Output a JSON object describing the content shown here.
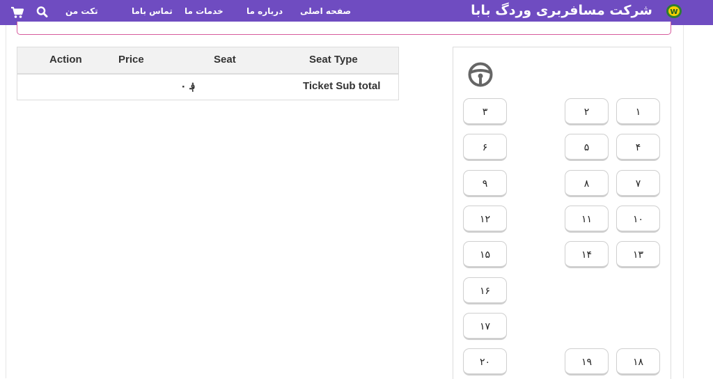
{
  "nav": {
    "brand": "شرکت مسافربری وردگ بابا",
    "links": [
      "صفحه اصلی",
      "درباره ما",
      "خدمات ما",
      "تماس باما",
      "تکت من"
    ]
  },
  "table": {
    "headers": [
      "Action",
      "Price",
      "Seat",
      "Seat Type"
    ],
    "subtotal_label": "Ticket Sub total",
    "subtotal_value": "۰ ؋"
  },
  "seats": [
    "۱",
    "۲",
    "۳",
    "۴",
    "۵",
    "۶",
    "۷",
    "۸",
    "۹",
    "۱۰",
    "۱۱",
    "۱۲",
    "۱۳",
    "۱۴",
    "۱۵",
    "۱۶",
    "۱۷",
    "۱۸",
    "۱۹",
    "۲۰"
  ],
  "colors": {
    "nav": "#6f4cc1",
    "alert_border": "#d65a9c"
  },
  "icons": [
    "cart-icon",
    "search-icon",
    "steering-wheel-icon",
    "logo-icon"
  ]
}
